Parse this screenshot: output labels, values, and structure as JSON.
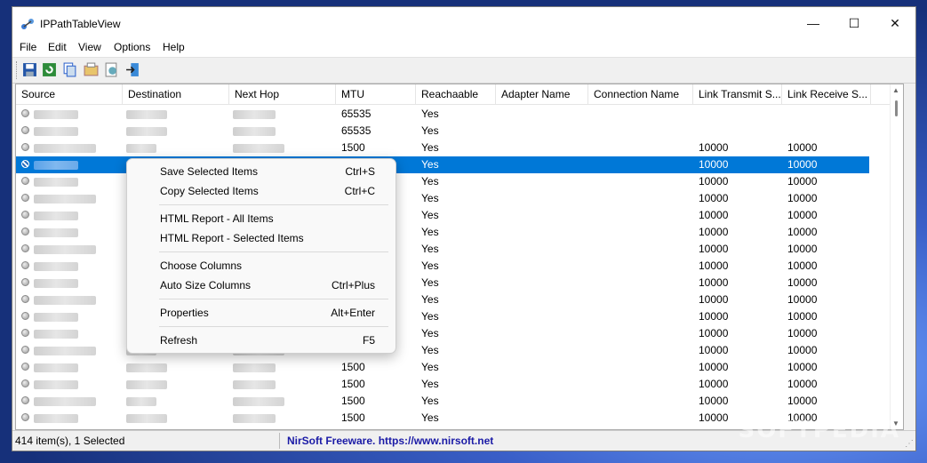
{
  "window": {
    "title": "IPPathTableView"
  },
  "menu": [
    "File",
    "Edit",
    "View",
    "Options",
    "Help"
  ],
  "toolbar": [
    "save-icon",
    "refresh-icon",
    "copy-icon",
    "properties-icon",
    "html-report-icon",
    "exit-icon"
  ],
  "columns": [
    "Source",
    "Destination",
    "Next Hop",
    "MTU",
    "Reachaable",
    "Adapter Name",
    "Connection Name",
    "Link Transmit S...",
    "Link Receive S..."
  ],
  "rows": [
    {
      "mtu": "65535",
      "reach": "Yes",
      "tx": "",
      "rx": ""
    },
    {
      "mtu": "65535",
      "reach": "Yes",
      "tx": "",
      "rx": ""
    },
    {
      "mtu": "1500",
      "reach": "Yes",
      "tx": "10000",
      "rx": "10000"
    },
    {
      "mtu": "",
      "reach": "Yes",
      "tx": "10000",
      "rx": "10000",
      "selected": true
    },
    {
      "mtu": "",
      "reach": "Yes",
      "tx": "10000",
      "rx": "10000"
    },
    {
      "mtu": "",
      "reach": "Yes",
      "tx": "10000",
      "rx": "10000"
    },
    {
      "mtu": "",
      "reach": "Yes",
      "tx": "10000",
      "rx": "10000"
    },
    {
      "mtu": "",
      "reach": "Yes",
      "tx": "10000",
      "rx": "10000"
    },
    {
      "mtu": "",
      "reach": "Yes",
      "tx": "10000",
      "rx": "10000"
    },
    {
      "mtu": "",
      "reach": "Yes",
      "tx": "10000",
      "rx": "10000"
    },
    {
      "mtu": "",
      "reach": "Yes",
      "tx": "10000",
      "rx": "10000"
    },
    {
      "mtu": "",
      "reach": "Yes",
      "tx": "10000",
      "rx": "10000"
    },
    {
      "mtu": "",
      "reach": "Yes",
      "tx": "10000",
      "rx": "10000"
    },
    {
      "mtu": "",
      "reach": "Yes",
      "tx": "10000",
      "rx": "10000"
    },
    {
      "mtu": "",
      "reach": "Yes",
      "tx": "10000",
      "rx": "10000"
    },
    {
      "mtu": "1500",
      "reach": "Yes",
      "tx": "10000",
      "rx": "10000"
    },
    {
      "mtu": "1500",
      "reach": "Yes",
      "tx": "10000",
      "rx": "10000"
    },
    {
      "mtu": "1500",
      "reach": "Yes",
      "tx": "10000",
      "rx": "10000"
    },
    {
      "mtu": "1500",
      "reach": "Yes",
      "tx": "10000",
      "rx": "10000"
    }
  ],
  "context_menu": [
    {
      "label": "Save Selected Items",
      "shortcut": "Ctrl+S"
    },
    {
      "label": "Copy Selected Items",
      "shortcut": "Ctrl+C"
    },
    {
      "sep": true
    },
    {
      "label": "HTML Report - All Items",
      "shortcut": ""
    },
    {
      "label": "HTML Report - Selected Items",
      "shortcut": ""
    },
    {
      "sep": true
    },
    {
      "label": "Choose Columns",
      "shortcut": ""
    },
    {
      "label": "Auto Size Columns",
      "shortcut": "Ctrl+Plus"
    },
    {
      "sep": true
    },
    {
      "label": "Properties",
      "shortcut": "Alt+Enter"
    },
    {
      "sep": true
    },
    {
      "label": "Refresh",
      "shortcut": "F5"
    }
  ],
  "status": {
    "count": "414 item(s), 1 Selected",
    "link": "NirSoft Freeware. https://www.nirsoft.net"
  },
  "watermark": "SOFTPEDIA"
}
